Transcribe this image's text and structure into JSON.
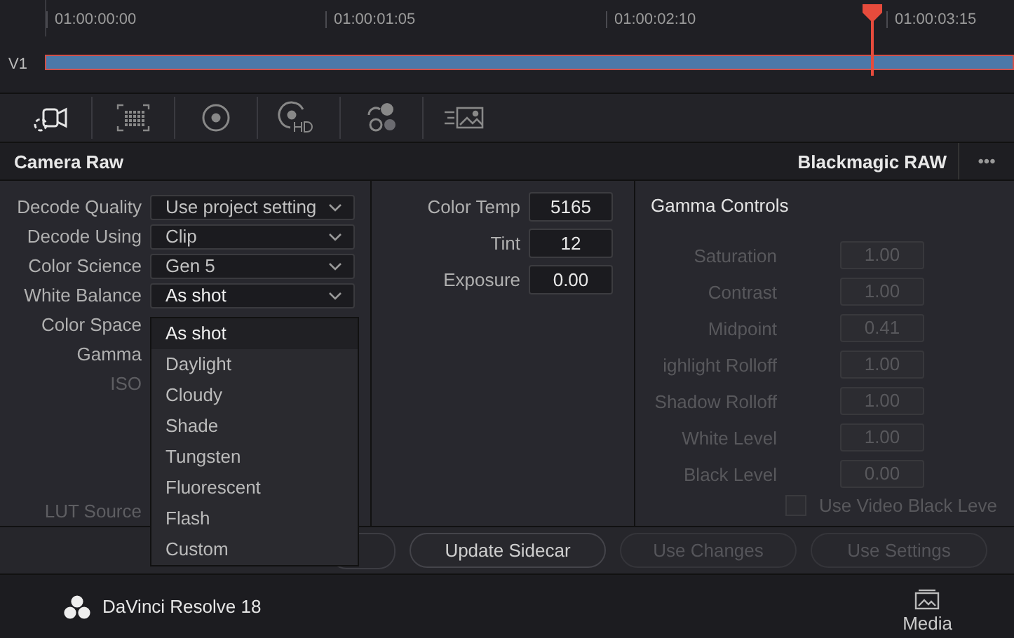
{
  "timeline": {
    "timecodes": [
      "01:00:00:00",
      "01:00:01:05",
      "01:00:02:10",
      "01:00:03:15"
    ],
    "track": "V1"
  },
  "toolbar": {
    "tools": [
      {
        "selected": true
      },
      {
        "selected": false
      },
      {
        "selected": false
      },
      {
        "selected": false
      },
      {
        "selected": false
      },
      {
        "selected": false
      }
    ]
  },
  "header": {
    "title": "Camera Raw",
    "format": "Blackmagic RAW",
    "menu": "•••"
  },
  "decode_settings": [
    {
      "label": "Decode Quality",
      "value": "Use project setting",
      "kind": "dropdown",
      "disabled": false
    },
    {
      "label": "Decode Using",
      "value": "Clip",
      "kind": "dropdown",
      "disabled": false
    },
    {
      "label": "Color Science",
      "value": "Gen 5",
      "kind": "dropdown",
      "disabled": false
    },
    {
      "label": "White Balance",
      "value": "As shot",
      "kind": "dropdown",
      "disabled": false
    },
    {
      "label": "Color Space",
      "kind": "label",
      "disabled": false
    },
    {
      "label": "Gamma",
      "kind": "label",
      "disabled": false
    },
    {
      "label": "ISO",
      "kind": "label",
      "disabled": true
    }
  ],
  "lut_source": {
    "label": "LUT Source",
    "disabled": true
  },
  "white_balance_menu": [
    {
      "label": "As shot",
      "selected": true
    },
    {
      "label": "Daylight",
      "selected": false
    },
    {
      "label": "Cloudy",
      "selected": false
    },
    {
      "label": "Shade",
      "selected": false
    },
    {
      "label": "Tungsten",
      "selected": false
    },
    {
      "label": "Fluorescent",
      "selected": false
    },
    {
      "label": "Flash",
      "selected": false
    },
    {
      "label": "Custom",
      "selected": false
    }
  ],
  "color_controls": [
    {
      "label": "Color Temp",
      "value": "5165"
    },
    {
      "label": "Tint",
      "value": "12"
    },
    {
      "label": "Exposure",
      "value": "0.00"
    }
  ],
  "gamma_controls": {
    "title": "Gamma Controls",
    "fields": [
      {
        "label": "Saturation",
        "value": "1.00",
        "disabled": true
      },
      {
        "label": "Contrast",
        "value": "1.00",
        "disabled": true
      },
      {
        "label": "Midpoint",
        "value": "0.41",
        "disabled": true
      },
      {
        "label": "ighlight Rolloff",
        "value": "1.00",
        "disabled": true
      },
      {
        "label": "Shadow Rolloff",
        "value": "1.00",
        "disabled": true
      },
      {
        "label": "White Level",
        "value": "1.00",
        "disabled": true
      },
      {
        "label": "Black Level",
        "value": "0.00",
        "disabled": true
      }
    ],
    "checkbox": {
      "label": "Use Video Black Leve",
      "checked": false,
      "disabled": true
    }
  },
  "buttons": [
    {
      "label": "Update Sidecar",
      "disabled": false
    },
    {
      "label": "Use Changes",
      "disabled": true
    },
    {
      "label": "Use Settings",
      "disabled": true
    }
  ],
  "footer": {
    "app": "DaVinci Resolve 18",
    "page": "Media"
  }
}
